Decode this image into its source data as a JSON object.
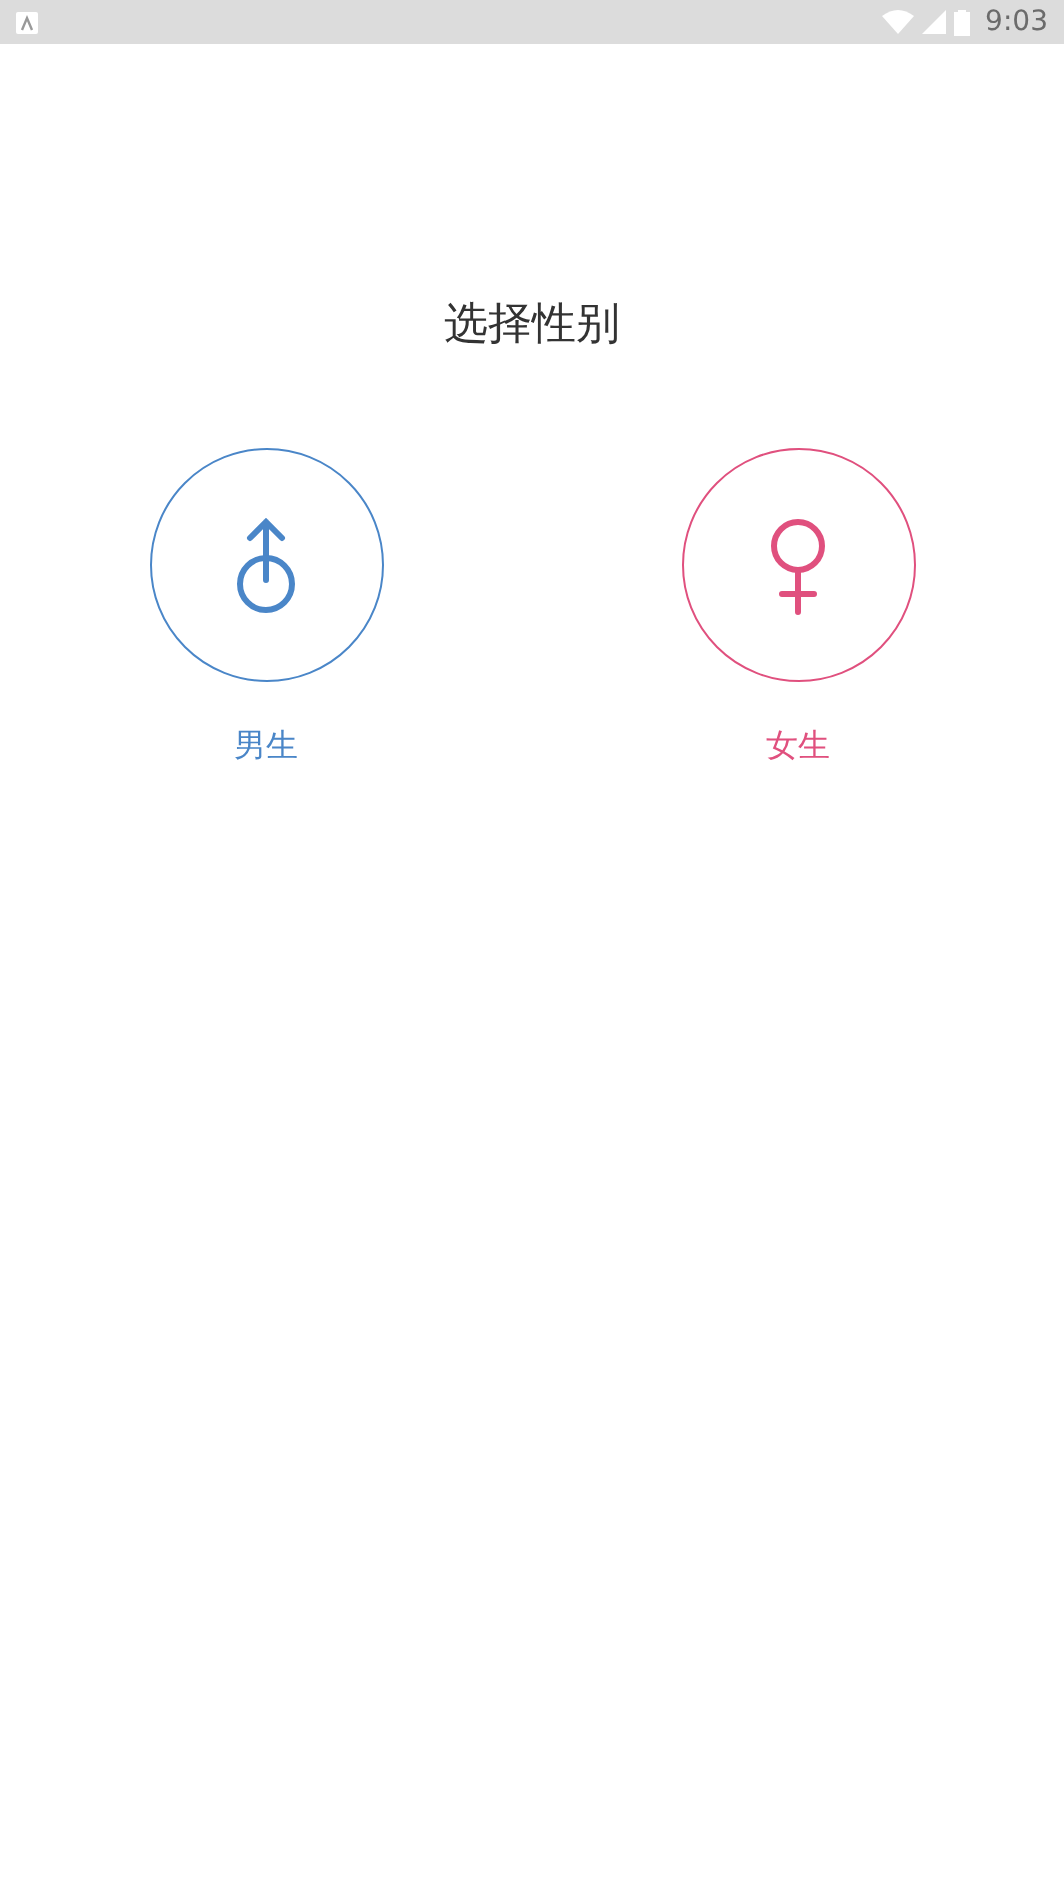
{
  "status_bar": {
    "time": "9:03"
  },
  "title": "选择性别",
  "options": [
    {
      "kind": "male",
      "label": "男生",
      "color": "#4a86c8"
    },
    {
      "kind": "female",
      "label": "女生",
      "color": "#e0507e"
    }
  ]
}
